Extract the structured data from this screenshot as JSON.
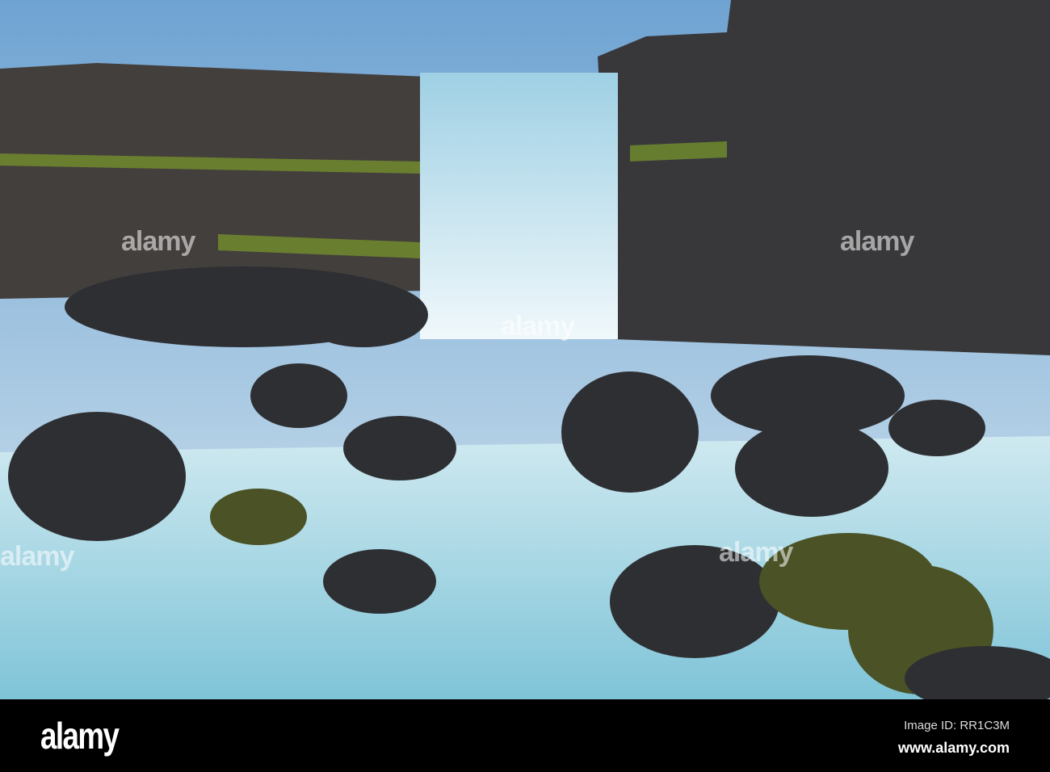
{
  "photo": {
    "subject": "waterfall",
    "colors": {
      "sky": "#8fb8d8",
      "rock": "#3a3a3c",
      "moss": "#7a9a2a",
      "water": "#bfe3ee"
    }
  },
  "watermark": {
    "text": "alamy"
  },
  "footer": {
    "logo": "alamy",
    "image_id": "Image ID: RR1C3M",
    "url": "www.alamy.com"
  }
}
